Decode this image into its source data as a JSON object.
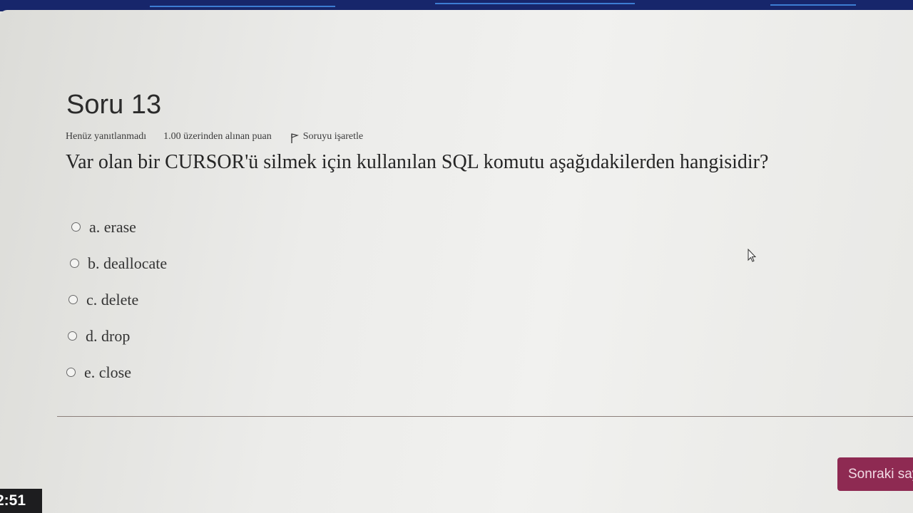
{
  "question": {
    "title": "Soru 13",
    "status": "Henüz yanıtlanmadı",
    "points": "1.00 üzerinden alınan puan",
    "flag_label": "Soruyu işaretle",
    "text": "Var olan bir CURSOR'ü silmek için kullanılan SQL komutu aşağıdakilerden hangisidir?"
  },
  "answers": [
    {
      "label": "a. erase"
    },
    {
      "label": "b. deallocate"
    },
    {
      "label": "c. delete"
    },
    {
      "label": "d. drop"
    },
    {
      "label": "e. close"
    }
  ],
  "navigation": {
    "next_label": "Sonraki sayfa"
  },
  "taskbar": {
    "clock": "2:51"
  },
  "colors": {
    "next_button": "#8e2a52",
    "banner": "#17266b"
  },
  "icons": {
    "flag": "flag-icon",
    "cursor": "mouse-pointer-icon"
  }
}
